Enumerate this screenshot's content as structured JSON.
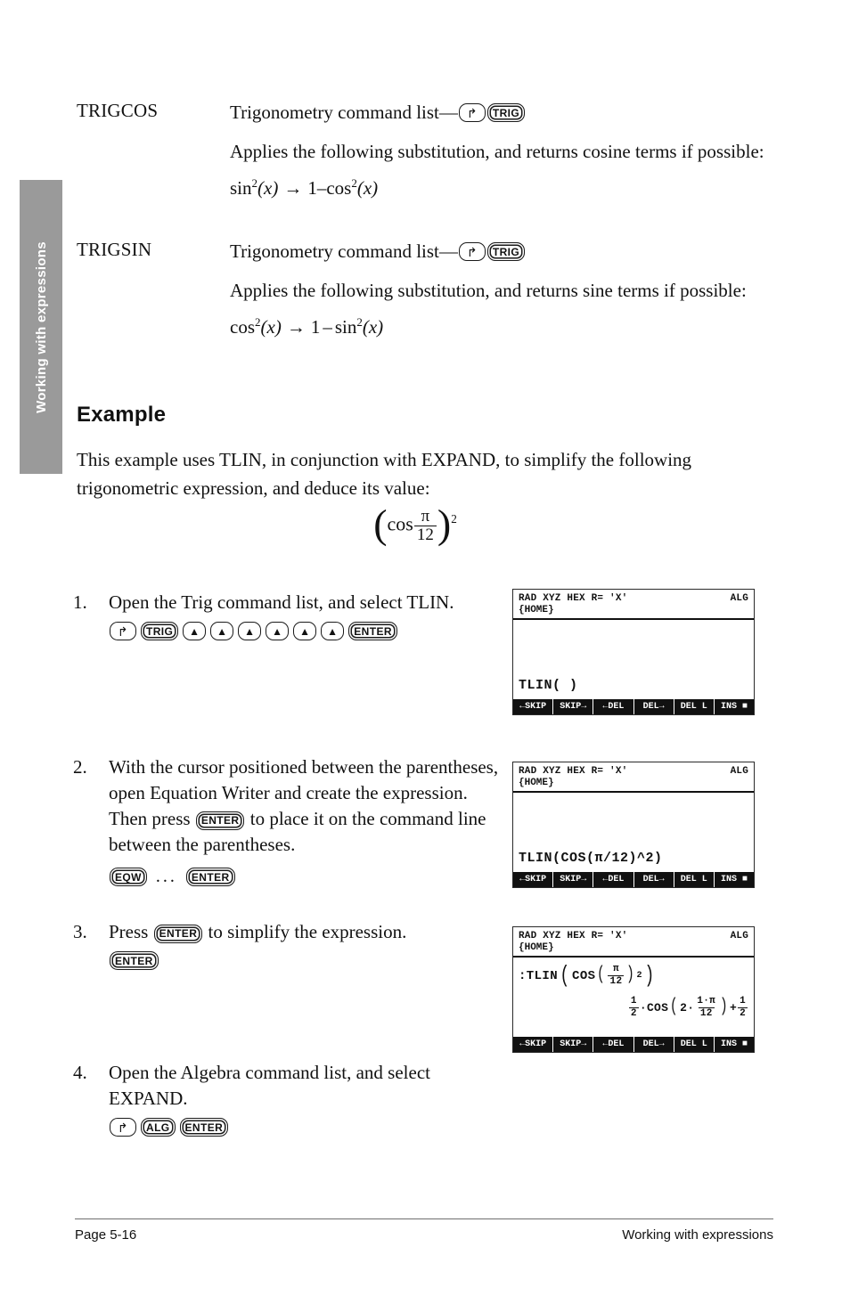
{
  "side_tab": {
    "label": "Working with expressions"
  },
  "commands": [
    {
      "name": "TRIGCOS",
      "source_text": "Trigonometry command list—",
      "keys": [
        "right-shift",
        "TRIG"
      ],
      "description": "Applies the following substitution, and returns cosine terms if possible:",
      "formula": {
        "lhs_fn": "sin",
        "lhs_exp": "2",
        "lhs_arg": "(x)",
        "arrow": "→",
        "rhs_pre": "1",
        "rhs_op": "–",
        "rhs_fn": "cos",
        "rhs_exp": "2",
        "rhs_arg": "(x)"
      }
    },
    {
      "name": "TRIGSIN",
      "source_text": "Trigonometry command list—",
      "keys": [
        "right-shift",
        "TRIG"
      ],
      "description": "Applies the following substitution, and returns sine terms if possible:",
      "formula": {
        "lhs_fn": "cos",
        "lhs_exp": "2",
        "lhs_arg": "(x)",
        "arrow": "→",
        "rhs_pre": "1",
        "rhs_op": "–",
        "rhs_fn": "sin",
        "rhs_exp": "2",
        "rhs_arg": "(x)"
      }
    }
  ],
  "example": {
    "heading": "Example",
    "intro": "This example uses TLIN, in conjunction with EXPAND, to simplify the following trigonometric expression, and deduce its value:",
    "display_formula": {
      "fn": "cos",
      "numerator": "π",
      "denominator": "12",
      "exponent": "2"
    }
  },
  "steps": [
    {
      "number": "1.",
      "text": "Open the Trig command list, and select TLIN.",
      "keys": [
        "right-shift",
        "TRIG",
        "up",
        "up",
        "up",
        "up",
        "up",
        "up",
        "ENTER"
      ]
    },
    {
      "number": "2.",
      "text_a": "With the cursor positioned between the parentheses, open Equation Writer and create the expression. Then press ",
      "inline_key": "ENTER",
      "text_b": " to place it on the command line between the parentheses.",
      "keys": [
        "EQW",
        "...",
        "ENTER"
      ]
    },
    {
      "number": "3.",
      "text_a": "Press ",
      "inline_key": "ENTER",
      "text_b": " to simplify the expression.",
      "keys": [
        "ENTER"
      ]
    },
    {
      "number": "4.",
      "text": "Open the Algebra command list, and select EXPAND.",
      "keys": [
        "right-shift",
        "ALG",
        "ENTER"
      ]
    }
  ],
  "key_labels": {
    "right_shift": "↱",
    "trig": "TRIG",
    "alg": "ALG",
    "enter": "ENTER",
    "eqw": "EQW",
    "up_arrow": "▲",
    "ellipsis": "..."
  },
  "screens": [
    {
      "status_left": "RAD XYZ HEX R= 'X'",
      "status_right": "ALG",
      "home": "{HOME}",
      "command_line": "TLIN( )",
      "menu": [
        "←SKIP",
        "SKIP→",
        "←DEL",
        "DEL→",
        "DEL L",
        "INS ■"
      ]
    },
    {
      "status_left": "RAD XYZ HEX R= 'X'",
      "status_right": "ALG",
      "home": "{HOME}",
      "command_line": "TLIN(COS(π/12)^2)",
      "menu": [
        "←SKIP",
        "SKIP→",
        "←DEL",
        "DEL→",
        "DEL L",
        "INS ■"
      ]
    },
    {
      "status_left": "RAD XYZ HEX R= 'X'",
      "status_right": "ALG",
      "home": "{HOME}",
      "expression_prompt": ":TLIN",
      "expression_fn": "COS",
      "expression_num": "π",
      "expression_den": "12",
      "expression_exp": "2",
      "result_half_num": "1",
      "result_half_den": "2",
      "result_fn": "COS",
      "result_factor": "2·",
      "result_inner_num": "1·π",
      "result_inner_den": "12",
      "result_plus": "+",
      "result_tail_num": "1",
      "result_tail_den": "2",
      "menu": [
        "←SKIP",
        "SKIP→",
        "←DEL",
        "DEL→",
        "DEL L",
        "INS ■"
      ]
    }
  ],
  "footer": {
    "page": "Page 5-16",
    "chapter": "Working with expressions"
  }
}
